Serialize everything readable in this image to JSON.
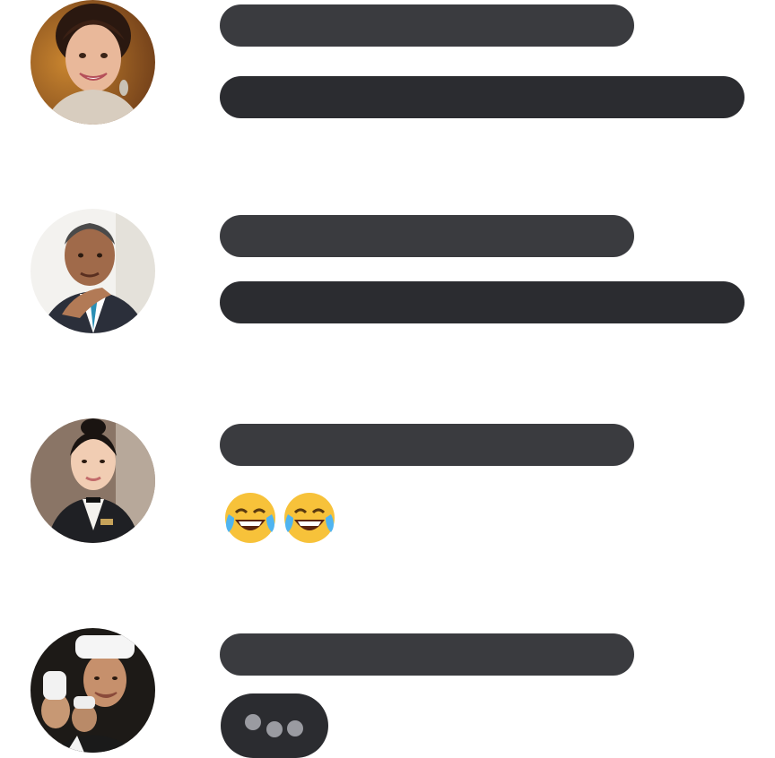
{
  "messages": [
    {
      "avatar": "woman-smiling-avatar",
      "content": "text-lines"
    },
    {
      "avatar": "man-in-suit-avatar",
      "content": "text-lines"
    },
    {
      "avatar": "hotel-receptionist-avatar",
      "content": "emoji-reaction",
      "emojis": [
        "😂",
        "😂"
      ]
    },
    {
      "avatar": "chefs-group-avatar",
      "content": "typing-indicator"
    }
  ],
  "colors": {
    "background": "#ffffff",
    "pill_dark": "#2b2c30",
    "pill_medium": "#3a3b3f",
    "typing_dot": "#9a9ba1"
  },
  "icons": {
    "emoji": "face-with-tears-of-joy",
    "typing": "typing-dots-icon"
  }
}
